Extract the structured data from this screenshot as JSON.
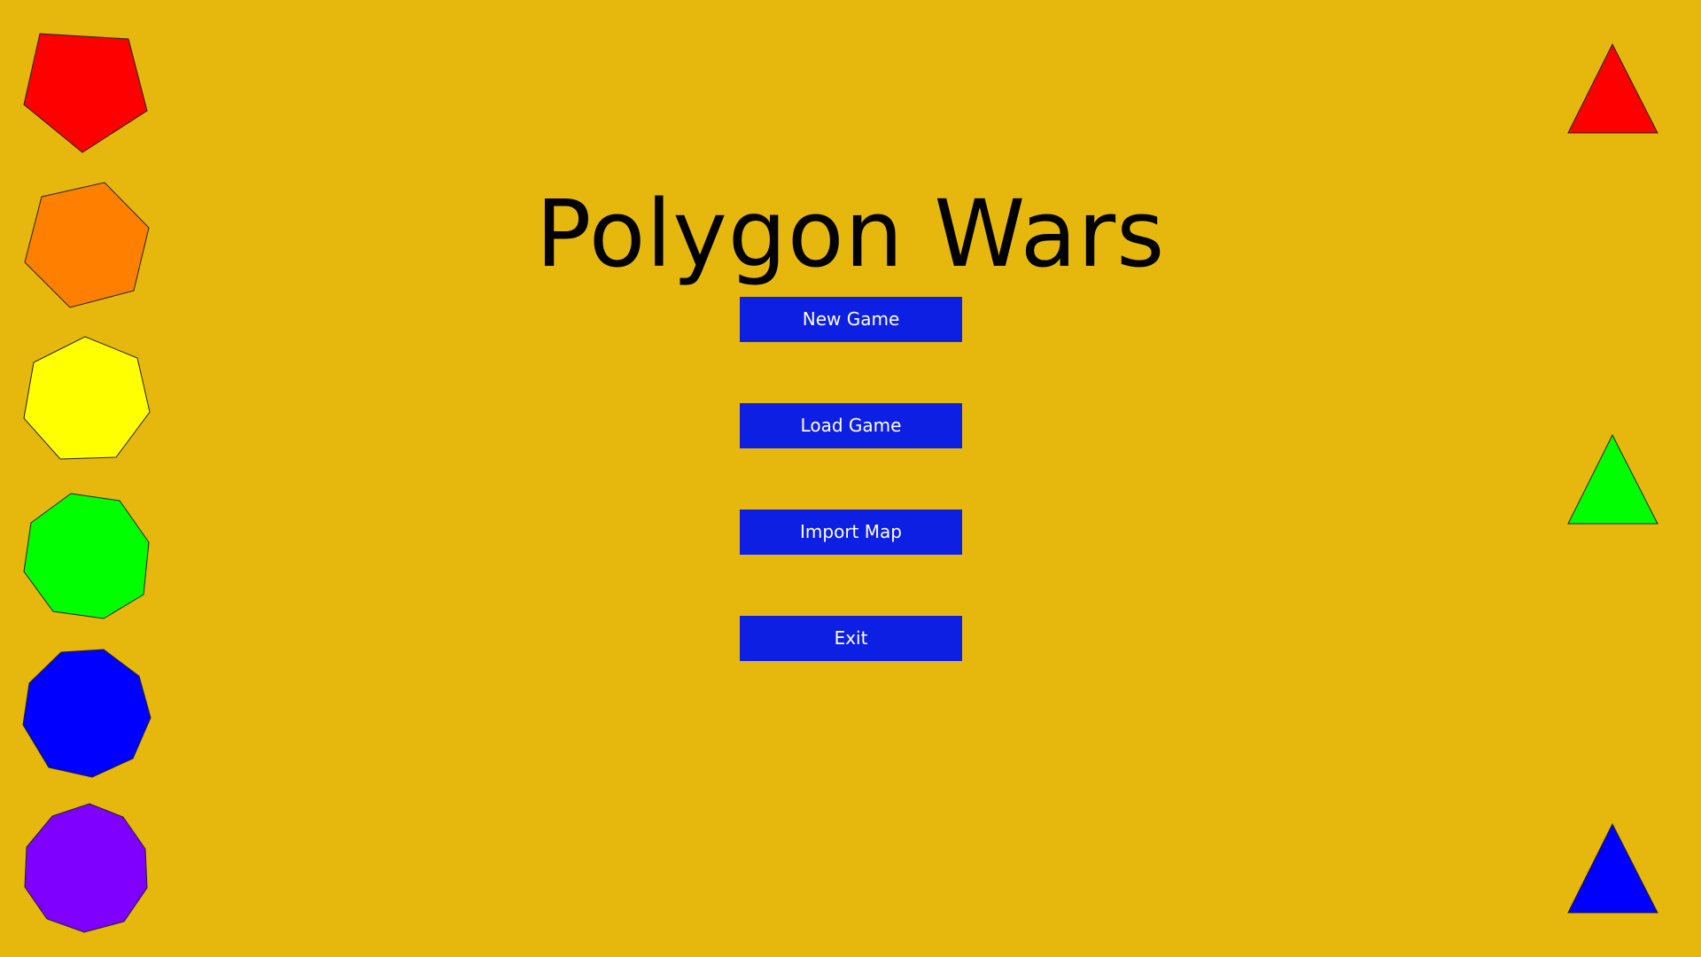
{
  "game": {
    "title": "Polygon Wars",
    "background_color": "#e6b80e"
  },
  "menu": {
    "new_game": "New Game",
    "load_game": "Load Game",
    "import_map": "Import Map",
    "exit": "Exit",
    "button_color": "#0d1fe3",
    "text_color": "#ffffff"
  },
  "decorations": {
    "left_polygons": [
      {
        "name": "pentagon-icon",
        "color": "#ff0000",
        "sides": 5
      },
      {
        "name": "hexagon-icon",
        "color": "#ff8000",
        "sides": 6
      },
      {
        "name": "heptagon-icon",
        "color": "#ffff00",
        "sides": 7
      },
      {
        "name": "octagon-icon",
        "color": "#00ff00",
        "sides": 8
      },
      {
        "name": "nonagon-icon",
        "color": "#0000ff",
        "sides": 9
      },
      {
        "name": "decagon-icon",
        "color": "#8000ff",
        "sides": 10
      }
    ],
    "right_triangles": [
      {
        "name": "red-triangle-icon",
        "color": "#ff0000"
      },
      {
        "name": "green-triangle-icon",
        "color": "#00ff00"
      },
      {
        "name": "blue-triangle-icon",
        "color": "#0000ff"
      }
    ]
  }
}
